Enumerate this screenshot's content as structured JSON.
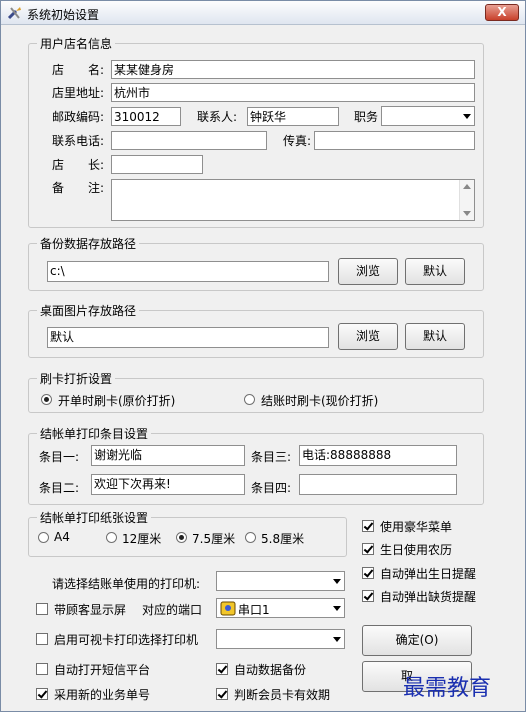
{
  "window": {
    "title": "系统初始设置",
    "close_label": "X"
  },
  "store": {
    "group_title": "用户店名信息",
    "name_label": "店　　名:",
    "name_value": "某某健身房",
    "address_label": "店里地址:",
    "address_value": "杭州市",
    "postcode_label": "邮政编码:",
    "postcode_value": "310012",
    "contact_label": "联系人:",
    "contact_value": "钟跃华",
    "position_label": "职务",
    "position_value": "",
    "phone_label": "联系电话:",
    "phone_value": "",
    "fax_label": "传真:",
    "fax_value": "",
    "manager_label": "店　　长:",
    "manager_value": "",
    "note_label": "备　　注:",
    "note_value": ""
  },
  "backup": {
    "group_title": "备份数据存放路径",
    "path_value": "c:\\",
    "browse_label": "浏览",
    "default_label": "默认"
  },
  "desktop": {
    "group_title": "桌面图片存放路径",
    "path_value": "默认",
    "browse_label": "浏览",
    "default_label": "默认"
  },
  "card": {
    "group_title": "刷卡打折设置",
    "option1": "开单时刷卡(原价打折)",
    "option2": "结账时刷卡(现价打折)"
  },
  "receipt": {
    "group_title": "结帐单打印条目设置",
    "item1_label": "条目一:",
    "item1_value": "谢谢光临",
    "item2_label": "条目二:",
    "item2_value": "欢迎下次再来!",
    "item3_label": "条目三:",
    "item3_value": "电话:88888888",
    "item4_label": "条目四:",
    "item4_value": ""
  },
  "paper": {
    "group_title": "结帐单打印纸张设置",
    "options": [
      "A4",
      "12厘米",
      "7.5厘米",
      "5.8厘米"
    ],
    "selected": "7.5厘米"
  },
  "options": {
    "luxury_menu": "使用豪华菜单",
    "lunar_birthday": "生日使用农历",
    "birthday_popup": "自动弹出生日提醒",
    "stock_popup": "自动弹出缺货提醒",
    "printer_label": "请选择结账单使用的打印机:",
    "printer_value": "",
    "customer_display": "带顾客显示屏",
    "port_label": "对应的端口",
    "port_value": "串口1",
    "visual_print": "启用可视卡打印选择打印机",
    "visual_printer_value": "",
    "sms_platform": "自动打开短信平台",
    "auto_backup": "自动数据备份",
    "new_order_no": "采用新的业务单号",
    "check_member_card": "判断会员卡有效期"
  },
  "buttons": {
    "ok_label": "确定(O)",
    "cancel_label": "取"
  },
  "watermark": "最需教育"
}
